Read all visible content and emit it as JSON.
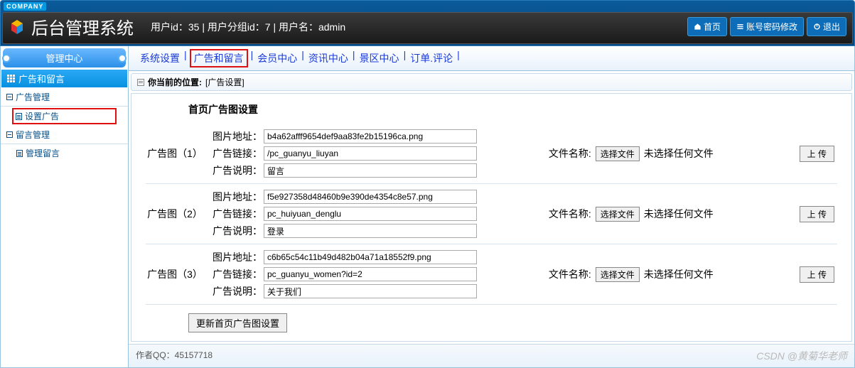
{
  "header": {
    "company_badge": "COMPANY",
    "system_title": "后台管理系统",
    "user_info": "用户id：35 | 用户分组id：7 | 用户名：admin",
    "links": {
      "home": "首页",
      "password": "账号密码修改",
      "logout": "退出"
    }
  },
  "sidebar": {
    "center_title": "管理中心",
    "section_title": "广告和留言",
    "groups": [
      {
        "label": "广告管理",
        "items": [
          "设置广告"
        ]
      },
      {
        "label": "留言管理",
        "items": [
          "管理留言"
        ]
      }
    ]
  },
  "topnav": {
    "items": [
      "系统设置",
      "广告和留言",
      "会员中心",
      "资讯中心",
      "景区中心",
      "订单.评论"
    ],
    "highlighted": "广告和留言"
  },
  "breadcrumb": {
    "prefix": "你当前的位置:",
    "current": "[广告设置]"
  },
  "content": {
    "title": "首页广告图设置",
    "field_labels": {
      "img": "图片地址：",
      "link": "广告链接：",
      "desc": "广告说明："
    },
    "file_label": "文件名称:",
    "choose_file": "选择文件",
    "no_file": "未选择任何文件",
    "upload": "上 传",
    "submit": "更新首页广告图设置",
    "ads": [
      {
        "label": "广告图（1）",
        "img": "b4a62afff9654def9aa83fe2b15196ca.png",
        "link": "/pc_guanyu_liuyan",
        "desc": "留言"
      },
      {
        "label": "广告图（2）",
        "img": "f5e927358d48460b9e390de4354c8e57.png",
        "link": "pc_huiyuan_denglu",
        "desc": "登录"
      },
      {
        "label": "广告图（3）",
        "img": "c6b65c54c11b49d482b04a71a18552f9.png",
        "link": "pc_guanyu_women?id=2",
        "desc": "关于我们"
      }
    ]
  },
  "footer": {
    "left": "作者QQ：45157718",
    "right": "CSDN @黄菊华老师"
  }
}
